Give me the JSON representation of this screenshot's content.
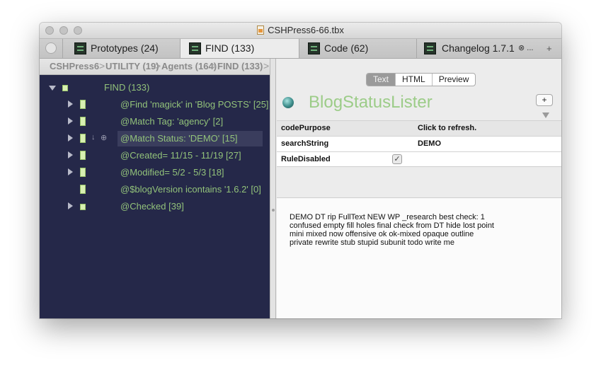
{
  "window": {
    "title": "CSHPress6-66.tbx"
  },
  "tabs": [
    {
      "label": "Prototypes (24)"
    },
    {
      "label": "FIND (133)"
    },
    {
      "label": "Code (62)"
    },
    {
      "label": "Changelog 1.7.1",
      "close": "⊗ ..."
    }
  ],
  "tab_add": "+",
  "breadcrumb": [
    "CSHPress6",
    "UTILITY (19)",
    "Agents (164)",
    "FIND (133)"
  ],
  "tree": [
    {
      "label": "FIND (133)"
    },
    {
      "label": "@Find 'magick' in 'Blog POSTS' [25]"
    },
    {
      "label": "@Match Tag: 'agency' [2]"
    },
    {
      "label": "@Match Status: 'DEMO' [15]"
    },
    {
      "label": "@Created= 11/15 - 11/19 [27]"
    },
    {
      "label": "@Modified= 5/2 - 5/3 [18]"
    },
    {
      "label": "@$blogVersion icontains '1.6.2' [0]"
    },
    {
      "label": "@Checked [39]"
    }
  ],
  "view_modes": [
    "Text",
    "HTML",
    "Preview"
  ],
  "note": {
    "title": "BlogStatusLister",
    "add_label": "+"
  },
  "attributes": [
    {
      "key": "codePurpose",
      "value": "Click to refresh."
    },
    {
      "key": "searchString",
      "value": "DEMO"
    },
    {
      "key": "RuleDisabled",
      "value": "✓"
    }
  ],
  "text_lines": [
    "DEMO   DT rip   FullText   NEW   WP   _research   best   check: 1",
    "confused   empty   fill holes   final check   from DT   hide   lost point",
    "mini   mixed   now   offensive   ok   ok-mixed   opaque   outline",
    "private   rewrite   stub   stupid   subunit   todo   write me"
  ],
  "colors": {
    "outline_bg": "#252849",
    "tree_text": "#92c27a",
    "title_green": "#9ccc88"
  }
}
